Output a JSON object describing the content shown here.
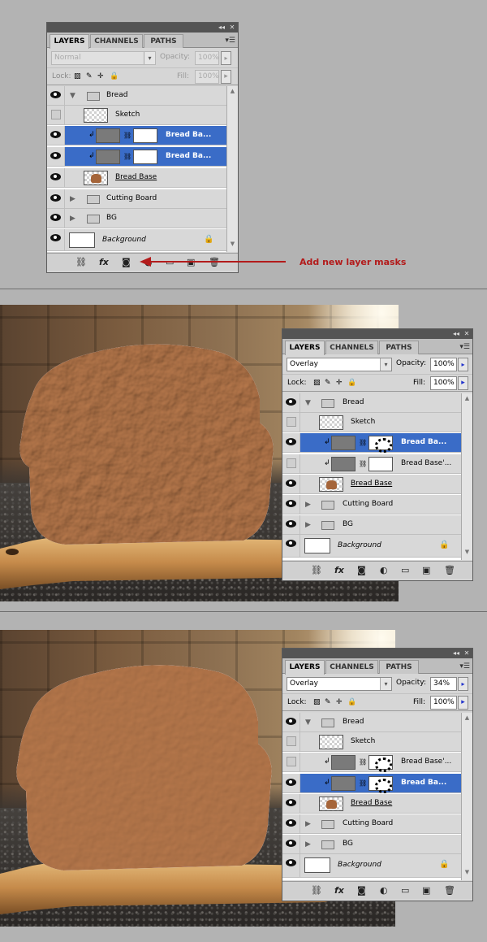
{
  "tabs": [
    "LAYERS",
    "CHANNELS",
    "PATHS"
  ],
  "annotation": "Add new layer masks",
  "panel1": {
    "blend_mode": "Normal",
    "opacity_label": "Opacity:",
    "opacity": "100%",
    "lock_label": "Lock:",
    "fill_label": "Fill:",
    "fill": "100%",
    "layers": [
      "Bread",
      "Sketch",
      "Bread Ba...",
      "Bread Ba...",
      "Bread Base",
      "Cutting Board",
      "BG",
      "Background"
    ]
  },
  "panel2": {
    "blend_mode": "Overlay",
    "opacity_label": "Opacity:",
    "opacity": "100%",
    "lock_label": "Lock:",
    "fill_label": "Fill:",
    "fill": "100%",
    "layers": [
      "Bread",
      "Sketch",
      "Bread Ba...",
      "Bread Base'...",
      "Bread Base",
      "Cutting Board",
      "BG",
      "Background"
    ]
  },
  "panel3": {
    "blend_mode": "Overlay",
    "opacity_label": "Opacity:",
    "opacity": "34%",
    "lock_label": "Lock:",
    "fill_label": "Fill:",
    "fill": "100%",
    "layers": [
      "Bread",
      "Sketch",
      "Bread Base'...",
      "Bread Ba...",
      "Bread Base",
      "Cutting Board",
      "BG",
      "Background"
    ]
  },
  "icons": [
    "link-icon",
    "fx-icon",
    "mask-icon",
    "adjustment-icon",
    "folder-icon",
    "new-layer-icon",
    "trash-icon",
    "eye-icon",
    "lock-icon"
  ],
  "colors": {
    "selection": "#3a6cc7",
    "bread": "#b8794c",
    "annotation": "#b31b1b"
  }
}
